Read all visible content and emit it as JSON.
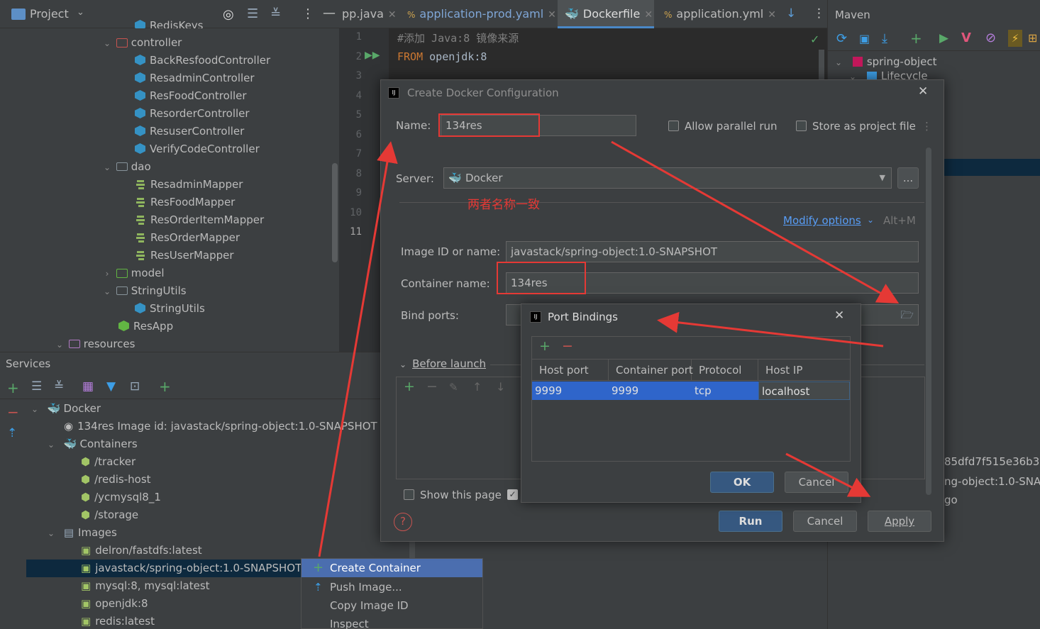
{
  "project_panel": {
    "title": "Project",
    "tree": [
      {
        "label": "RedisKeys",
        "type": "class"
      },
      {
        "label": "controller",
        "type": "package"
      },
      {
        "label": "BackResfoodController",
        "type": "class"
      },
      {
        "label": "ResadminController",
        "type": "class"
      },
      {
        "label": "ResFoodController",
        "type": "class"
      },
      {
        "label": "ResorderController",
        "type": "class"
      },
      {
        "label": "ResuserController",
        "type": "class"
      },
      {
        "label": "VerifyCodeController",
        "type": "class"
      },
      {
        "label": "dao",
        "type": "folder"
      },
      {
        "label": "ResadminMapper",
        "type": "mapper"
      },
      {
        "label": "ResFoodMapper",
        "type": "mapper"
      },
      {
        "label": "ResOrderItemMapper",
        "type": "mapper"
      },
      {
        "label": "ResOrderMapper",
        "type": "mapper"
      },
      {
        "label": "ResUserMapper",
        "type": "mapper"
      },
      {
        "label": "model",
        "type": "package"
      },
      {
        "label": "StringUtils",
        "type": "folder"
      },
      {
        "label": "StringUtils",
        "type": "class"
      },
      {
        "label": "ResApp",
        "type": "app"
      },
      {
        "label": "resources",
        "type": "resources"
      }
    ]
  },
  "editor": {
    "tabs": [
      {
        "label": "pp.java"
      },
      {
        "label": "application-prod.yaml"
      },
      {
        "label": "Dockerfile"
      },
      {
        "label": "application.yml"
      }
    ],
    "line_numbers": [
      "1",
      "2",
      "3",
      "4",
      "5",
      "6",
      "7",
      "8",
      "9",
      "10",
      "11"
    ],
    "code_line1": "#添加 Java:8 镜像来源",
    "code_line2_keyword": "FROM",
    "code_line2_rest": " openjdk:8"
  },
  "maven": {
    "title": "Maven",
    "project": "spring-object",
    "lifecycle": "Lifecycle",
    "peek1": "85dfd7f515e36b3",
    "peek2": "ng-object:1.0-SNA",
    "peek3": "go"
  },
  "services": {
    "title": "Services",
    "tree": {
      "docker": "Docker",
      "deployment": "134res Image id: javastack/spring-object:1.0-SNAPSHOT",
      "containers": "Containers",
      "container_items": [
        "/tracker",
        "/redis-host",
        "/ycmysql8_1",
        "/storage"
      ],
      "images": "Images",
      "image_items": [
        "delron/fastdfs:latest",
        "javastack/spring-object:1.0-SNAPSHOT",
        "mysql:8, mysql:latest",
        "openjdk:8",
        "redis:latest"
      ]
    }
  },
  "context_menu": {
    "items": [
      "Create Container",
      "Push Image...",
      "Copy Image ID",
      "Inspect"
    ]
  },
  "docker_dialog": {
    "title": "Create Docker Configuration",
    "name_label": "Name:",
    "name_value": "134res",
    "allow_parallel": "Allow parallel run",
    "store_project": "Store as project file",
    "server_label": "Server:",
    "server_value": "Docker",
    "annotation": "两者名称一致",
    "modify_options": "Modify options",
    "shortcut": "Alt+M",
    "image_label": "Image ID or name:",
    "image_value": "javastack/spring-object:1.0-SNAPSHOT",
    "container_label": "Container name:",
    "container_value": "134res",
    "bind_ports_label": "Bind ports:",
    "before_launch": "Before launch",
    "show_page": "Show this page",
    "run": "Run",
    "cancel": "Cancel",
    "apply": "Apply"
  },
  "port_dialog": {
    "title": "Port Bindings",
    "columns": [
      "Host port",
      "Container port",
      "Protocol",
      "Host IP"
    ],
    "row": {
      "host_port": "9999",
      "container_port": "9999",
      "protocol": "tcp",
      "host_ip": "localhost"
    },
    "ok": "OK",
    "cancel": "Cancel"
  },
  "colors": {
    "accent": "#4b6eaf",
    "annotation_red": "#e53935",
    "selection": "#0d293e"
  }
}
